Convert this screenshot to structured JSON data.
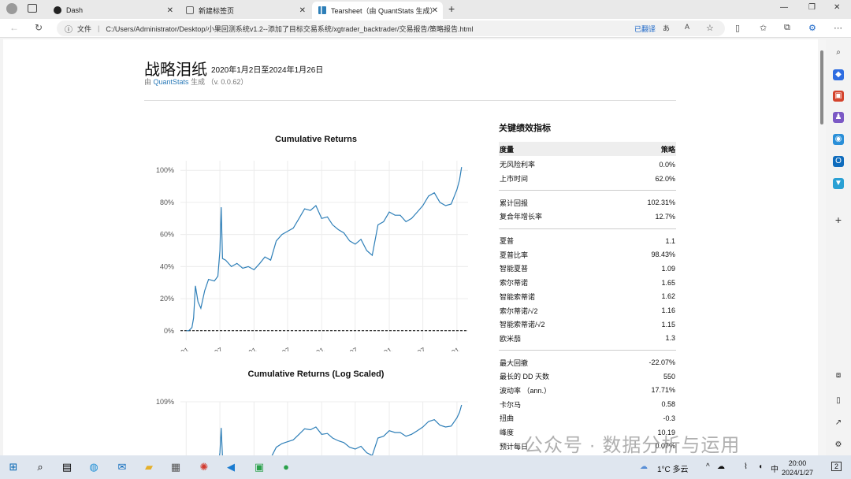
{
  "browser": {
    "tabs": [
      {
        "label": "Dash",
        "icon": "dash-icon"
      },
      {
        "label": "新建标签页",
        "icon": "newtab-icon"
      },
      {
        "label": "Tearsheet（由 QuantStats 生成）",
        "icon": "chart-icon"
      }
    ],
    "address": {
      "scheme_label": "文件",
      "url": "C:/Users/Administrator/Desktop/小果回测系统v1.2--添加了目标交易系统/xgtrader_backtrader/交易报告/策略报告.html",
      "translated_label": "已翻译"
    }
  },
  "report": {
    "title": "战略泪纸",
    "dates": "2020年1月2日至2024年1月26日",
    "gen_prefix": "由",
    "gen_link": "QuantStats",
    "gen_suffix": "生成 （v. 0.0.62）"
  },
  "chart_data": [
    {
      "type": "line",
      "title": "Cumulative Returns",
      "ylim": [
        -0.06,
        1.06
      ],
      "yticks": [
        "0%",
        "20%",
        "40%",
        "60%",
        "80%",
        "100%"
      ],
      "xticks": [
        "2020-01",
        "2020-07",
        "2021-01",
        "2021-07",
        "2022-01",
        "2022-07",
        "2023-01",
        "2023-07",
        "2024-01"
      ],
      "x": [
        "2020-01-02",
        "2020-01-15",
        "2020-02-01",
        "2020-02-10",
        "2020-02-20",
        "2020-03-05",
        "2020-03-20",
        "2020-04-10",
        "2020-05-01",
        "2020-06-01",
        "2020-06-20",
        "2020-07-01",
        "2020-07-08",
        "2020-07-15",
        "2020-08-01",
        "2020-09-01",
        "2020-10-01",
        "2020-11-01",
        "2020-12-01",
        "2021-01-01",
        "2021-02-01",
        "2021-03-01",
        "2021-04-01",
        "2021-05-01",
        "2021-06-01",
        "2021-07-01",
        "2021-08-01",
        "2021-09-01",
        "2021-10-01",
        "2021-11-01",
        "2021-12-01",
        "2022-01-01",
        "2022-02-01",
        "2022-03-01",
        "2022-04-01",
        "2022-05-01",
        "2022-06-01",
        "2022-07-01",
        "2022-08-01",
        "2022-09-01",
        "2022-10-01",
        "2022-11-01",
        "2022-12-01",
        "2023-01-01",
        "2023-02-01",
        "2023-03-01",
        "2023-04-01",
        "2023-05-01",
        "2023-06-01",
        "2023-07-01",
        "2023-08-01",
        "2023-09-01",
        "2023-10-01",
        "2023-11-01",
        "2023-12-01",
        "2024-01-01",
        "2024-01-15",
        "2024-01-26"
      ],
      "y": [
        0.0,
        0.0,
        0.02,
        0.08,
        0.28,
        0.18,
        0.14,
        0.25,
        0.32,
        0.31,
        0.34,
        0.5,
        0.77,
        0.45,
        0.44,
        0.4,
        0.42,
        0.39,
        0.4,
        0.38,
        0.42,
        0.46,
        0.44,
        0.56,
        0.6,
        0.62,
        0.64,
        0.7,
        0.76,
        0.75,
        0.78,
        0.7,
        0.71,
        0.66,
        0.63,
        0.61,
        0.56,
        0.54,
        0.57,
        0.5,
        0.47,
        0.66,
        0.68,
        0.74,
        0.72,
        0.72,
        0.68,
        0.7,
        0.74,
        0.78,
        0.84,
        0.86,
        0.8,
        0.78,
        0.79,
        0.88,
        0.94,
        1.02
      ]
    },
    {
      "type": "line",
      "title": "Cumulative Returns (Log Scaled)",
      "yticks": [
        "109%"
      ]
    }
  ],
  "metrics": {
    "title": "关键绩效指标",
    "header": {
      "metric": "度量",
      "strategy": "策略"
    },
    "groups": [
      [
        {
          "name": "无风险利率",
          "value": "0.0%"
        },
        {
          "name": "上市时间",
          "value": "62.0%"
        }
      ],
      [
        {
          "name": "累计回报",
          "value": "102.31%"
        },
        {
          "name": "复合年增长率",
          "value": "12.7%"
        }
      ],
      [
        {
          "name": "夏普",
          "value": "1.1"
        },
        {
          "name": "夏普比率",
          "value": "98.43%"
        },
        {
          "name": "智能夏普",
          "value": "1.09"
        },
        {
          "name": "索尔蒂诺",
          "value": "1.65"
        },
        {
          "name": "智能索蒂诺",
          "value": "1.62"
        },
        {
          "name": "索尔蒂诺/√2",
          "value": "1.16"
        },
        {
          "name": "智能索蒂诺/√2",
          "value": "1.15"
        },
        {
          "name": "欧米茄",
          "value": "1.3"
        }
      ],
      [
        {
          "name": "最大回撤",
          "value": "-22.07%"
        },
        {
          "name": "最长的 DD 天数",
          "value": "550"
        },
        {
          "name": "波动率 （ann.）",
          "value": "17.71%"
        },
        {
          "name": "卡尔马",
          "value": "0.58"
        },
        {
          "name": "扭曲",
          "value": "-0.3"
        },
        {
          "name": "峰度",
          "value": "10.19"
        },
        {
          "name": "预计每日",
          "value": "0.07%"
        }
      ]
    ]
  },
  "taskbar": {
    "weather": "1°C 多云",
    "ime": "中",
    "time": "20:00",
    "date": "2024/1/27",
    "notif_count": "2"
  },
  "watermark": "公众号 · 数据分析与运用",
  "colors": {
    "line": "#2e7fb8",
    "accent": "#1a66c8"
  }
}
